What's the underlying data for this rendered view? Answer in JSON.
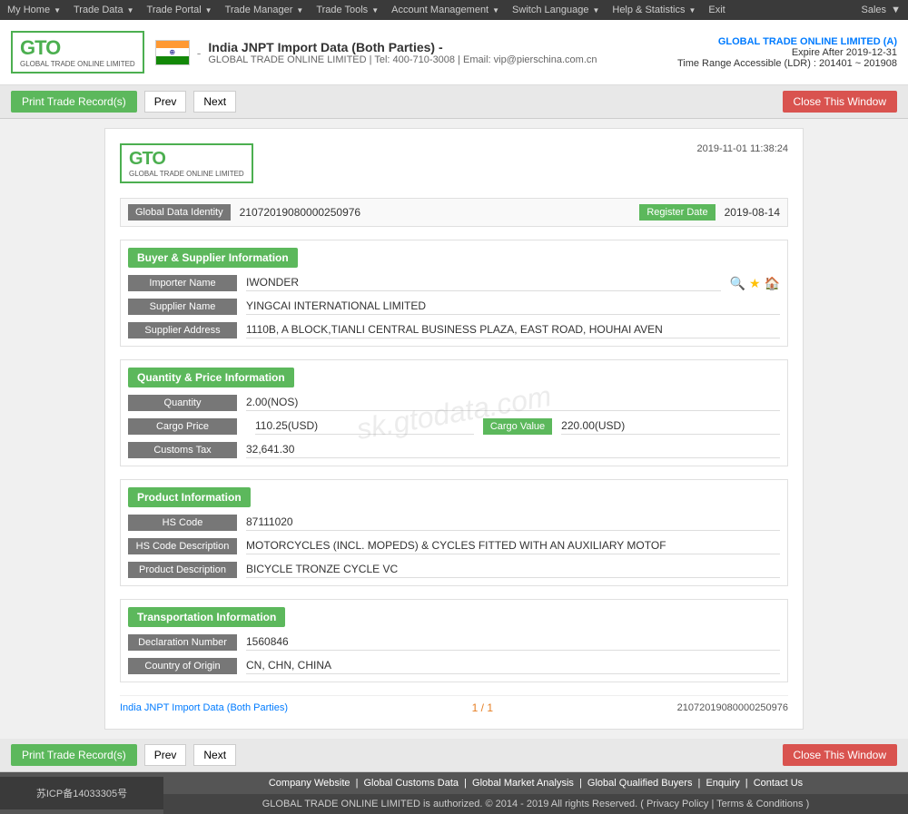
{
  "topnav": {
    "items": [
      {
        "label": "My Home",
        "has_arrow": true
      },
      {
        "label": "Trade Data",
        "has_arrow": true
      },
      {
        "label": "Trade Portal",
        "has_arrow": true
      },
      {
        "label": "Trade Manager",
        "has_arrow": true
      },
      {
        "label": "Trade Tools",
        "has_arrow": true
      },
      {
        "label": "Account Management",
        "has_arrow": true
      },
      {
        "label": "Switch Language",
        "has_arrow": true
      },
      {
        "label": "Help & Statistics",
        "has_arrow": true
      },
      {
        "label": "Exit",
        "has_arrow": false
      }
    ],
    "sales": "Sales"
  },
  "header": {
    "logo_main": "GTO",
    "logo_sub": "GLOBAL TRADE ONLINE LIMITED",
    "title": "India JNPT Import Data (Both Parties)  -",
    "subtitle": "GLOBAL TRADE ONLINE LIMITED | Tel: 400-710-3008 | Email: vip@pierschina.com.cn",
    "company": "GLOBAL TRADE ONLINE LIMITED (A)",
    "expire": "Expire After 2019-12-31",
    "ldr": "Time Range Accessible (LDR) : 201401 ~ 201908"
  },
  "toolbar": {
    "print_label": "Print Trade Record(s)",
    "prev_label": "Prev",
    "next_label": "Next",
    "close_label": "Close This Window"
  },
  "record": {
    "timestamp": "2019-11-01 11:38:24",
    "global_data_identity_label": "Global Data Identity",
    "global_data_identity_value": "21072019080000250976",
    "register_date_label": "Register Date",
    "register_date_value": "2019-08-14",
    "sections": {
      "buyer_supplier": {
        "title": "Buyer & Supplier Information",
        "importer_label": "Importer Name",
        "importer_value": "IWONDER",
        "supplier_label": "Supplier Name",
        "supplier_value": "YINGCAI INTERNATIONAL LIMITED",
        "address_label": "Supplier Address",
        "address_value": "1110B, A BLOCK,TIANLI CENTRAL BUSINESS PLAZA, EAST ROAD, HOUHAI AVEN"
      },
      "quantity_price": {
        "title": "Quantity & Price Information",
        "quantity_label": "Quantity",
        "quantity_value": "2.00(NOS)",
        "cargo_price_label": "Cargo Price",
        "cargo_price_value": "110.25(USD)",
        "cargo_value_label": "Cargo Value",
        "cargo_value_value": "220.00(USD)",
        "customs_tax_label": "Customs Tax",
        "customs_tax_value": "32,641.30"
      },
      "product": {
        "title": "Product Information",
        "hs_code_label": "HS Code",
        "hs_code_value": "87111020",
        "hs_desc_label": "HS Code Description",
        "hs_desc_value": "MOTORCYCLES (INCL. MOPEDS) & CYCLES FITTED WITH AN AUXILIARY MOTOF",
        "product_desc_label": "Product Description",
        "product_desc_value": "BICYCLE TRONZE CYCLE VC"
      },
      "transportation": {
        "title": "Transportation Information",
        "declaration_label": "Declaration Number",
        "declaration_value": "1560846",
        "country_label": "Country of Origin",
        "country_value": "CN, CHN, CHINA"
      }
    },
    "footer": {
      "left": "India JNPT Import Data (Both Parties)",
      "center": "1 / 1",
      "right": "21072019080000250976"
    },
    "watermark": "sk.gtodata.com"
  },
  "footer": {
    "icp": "苏ICP备14033305号",
    "links": [
      "Company Website",
      "Global Customs Data",
      "Global Market Analysis",
      "Global Qualified Buyers",
      "Enquiry",
      "Contact Us"
    ],
    "copyright": "GLOBAL TRADE ONLINE LIMITED is authorized. © 2014 - 2019 All rights Reserved.  (  Privacy Policy  |  Terms & Conditions  )"
  }
}
